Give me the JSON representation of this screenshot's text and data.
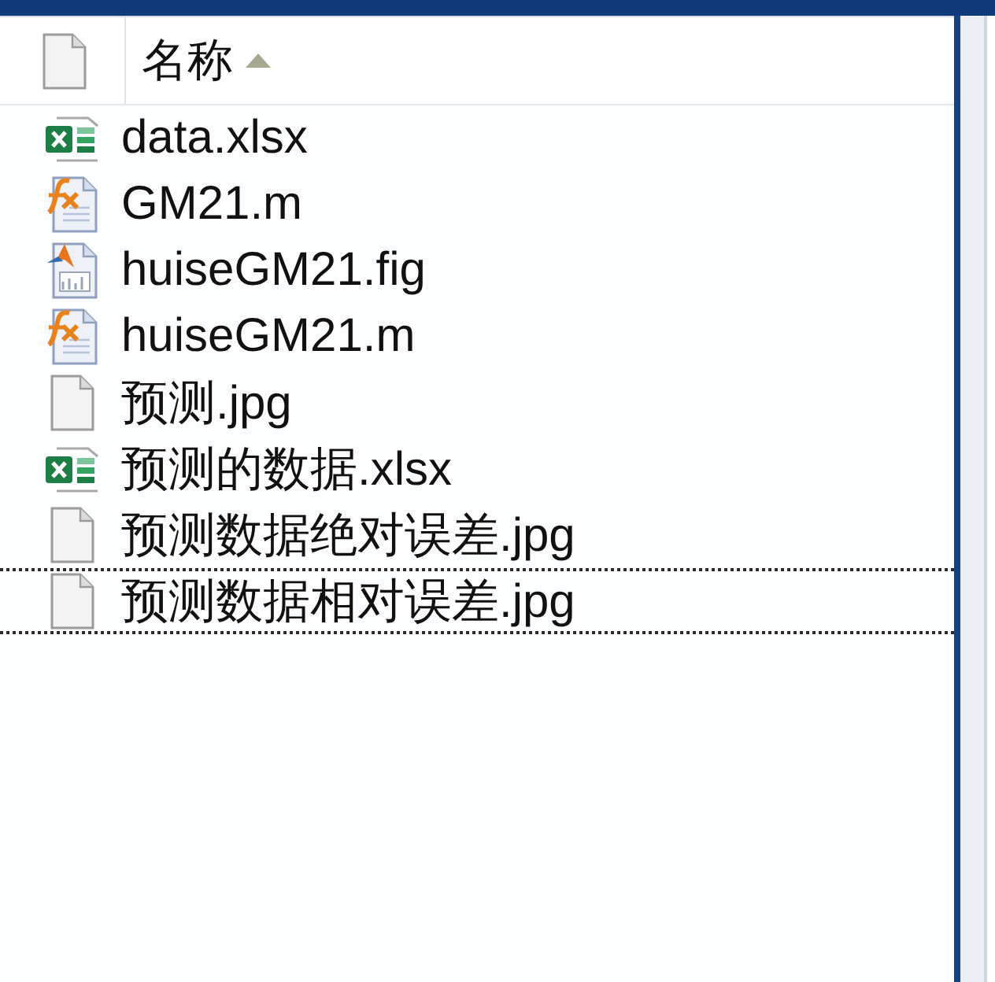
{
  "header": {
    "name_label": "名称",
    "sort_ascending": true
  },
  "files": [
    {
      "name": "data.xlsx",
      "kind": "spreadsheet",
      "selected": false
    },
    {
      "name": "GM21.m",
      "kind": "script",
      "selected": false
    },
    {
      "name": "huiseGM21.fig",
      "kind": "figure",
      "selected": false
    },
    {
      "name": "huiseGM21.m",
      "kind": "script",
      "selected": false
    },
    {
      "name": "预测.jpg",
      "kind": "blank",
      "selected": false
    },
    {
      "name": "预测的数据.xlsx",
      "kind": "spreadsheet",
      "selected": false
    },
    {
      "name": "预测数据绝对误差.jpg",
      "kind": "blank",
      "selected": false
    },
    {
      "name": "预测数据相对误差.jpg",
      "kind": "blank",
      "selected": true
    }
  ]
}
